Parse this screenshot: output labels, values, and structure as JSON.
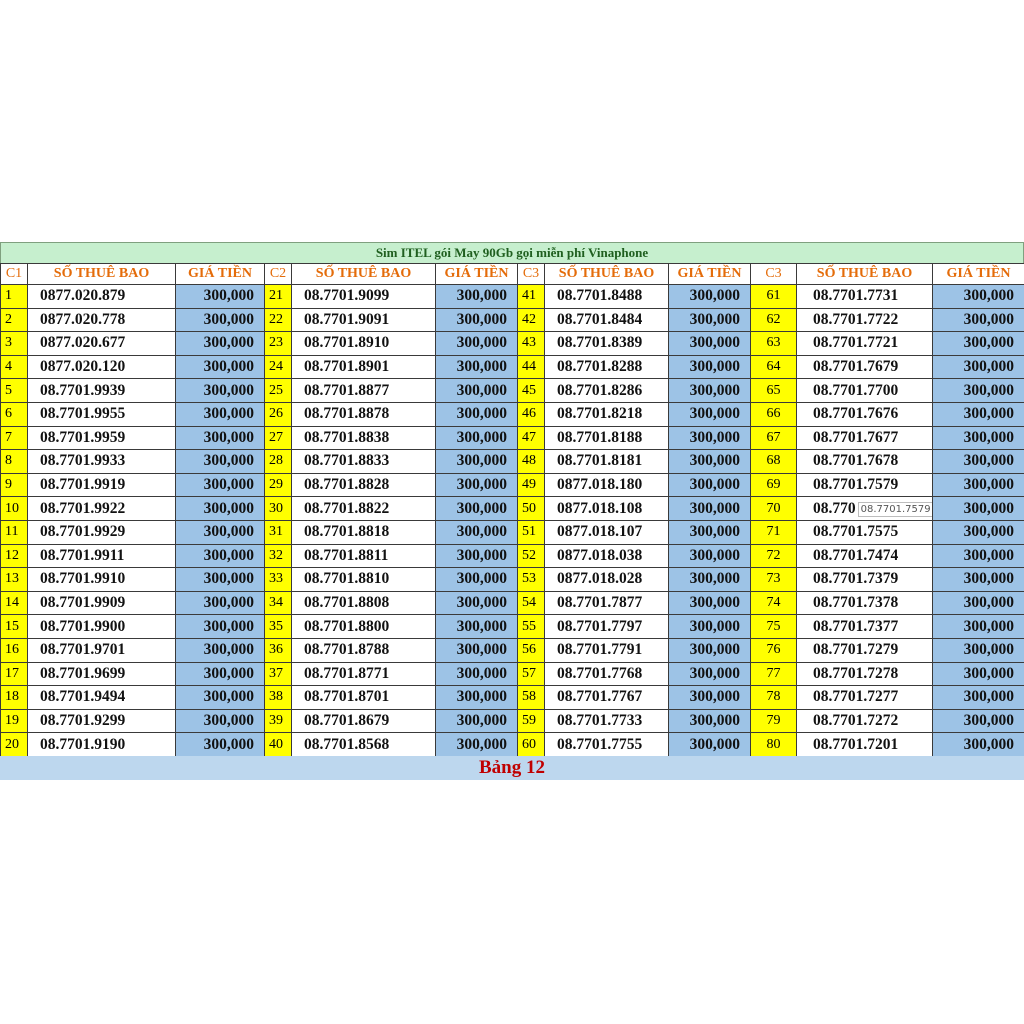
{
  "title": "Sim ITEL gói May 90Gb gọi miễn phí Vinaphone",
  "headers": {
    "groups": [
      "C1",
      "C2",
      "C3",
      "C3"
    ],
    "number_col": "SỐ THUÊ BAO",
    "price_col": "GIÁ TIỀN"
  },
  "tooltip": "08.7701.7579",
  "footer": "Bảng 12",
  "colors": {
    "title_bg": "#c6efce",
    "index_bg": "#ffff00",
    "price_bg": "#9dc3e6",
    "header_text": "#e46c0a",
    "footer_bg": "#bdd7ee",
    "footer_text": "#c00000"
  },
  "rows": [
    [
      {
        "i": "1",
        "n": "0877.020.879",
        "p": "300,000"
      },
      {
        "i": "21",
        "n": "08.7701.9099",
        "p": "300,000"
      },
      {
        "i": "41",
        "n": "08.7701.8488",
        "p": "300,000"
      },
      {
        "i": "61",
        "n": "08.7701.7731",
        "p": "300,000"
      }
    ],
    [
      {
        "i": "2",
        "n": "0877.020.778",
        "p": "300,000"
      },
      {
        "i": "22",
        "n": "08.7701.9091",
        "p": "300,000"
      },
      {
        "i": "42",
        "n": "08.7701.8484",
        "p": "300,000"
      },
      {
        "i": "62",
        "n": "08.7701.7722",
        "p": "300,000"
      }
    ],
    [
      {
        "i": "3",
        "n": "0877.020.677",
        "p": "300,000"
      },
      {
        "i": "23",
        "n": "08.7701.8910",
        "p": "300,000"
      },
      {
        "i": "43",
        "n": "08.7701.8389",
        "p": "300,000"
      },
      {
        "i": "63",
        "n": "08.7701.7721",
        "p": "300,000"
      }
    ],
    [
      {
        "i": "4",
        "n": "0877.020.120",
        "p": "300,000"
      },
      {
        "i": "24",
        "n": "08.7701.8901",
        "p": "300,000"
      },
      {
        "i": "44",
        "n": "08.7701.8288",
        "p": "300,000"
      },
      {
        "i": "64",
        "n": "08.7701.7679",
        "p": "300,000"
      }
    ],
    [
      {
        "i": "5",
        "n": "08.7701.9939",
        "p": "300,000"
      },
      {
        "i": "25",
        "n": "08.7701.8877",
        "p": "300,000"
      },
      {
        "i": "45",
        "n": "08.7701.8286",
        "p": "300,000"
      },
      {
        "i": "65",
        "n": "08.7701.7700",
        "p": "300,000"
      }
    ],
    [
      {
        "i": "6",
        "n": "08.7701.9955",
        "p": "300,000"
      },
      {
        "i": "26",
        "n": "08.7701.8878",
        "p": "300,000"
      },
      {
        "i": "46",
        "n": "08.7701.8218",
        "p": "300,000"
      },
      {
        "i": "66",
        "n": "08.7701.7676",
        "p": "300,000"
      }
    ],
    [
      {
        "i": "7",
        "n": "08.7701.9959",
        "p": "300,000"
      },
      {
        "i": "27",
        "n": "08.7701.8838",
        "p": "300,000"
      },
      {
        "i": "47",
        "n": "08.7701.8188",
        "p": "300,000"
      },
      {
        "i": "67",
        "n": "08.7701.7677",
        "p": "300,000"
      }
    ],
    [
      {
        "i": "8",
        "n": "08.7701.9933",
        "p": "300,000"
      },
      {
        "i": "28",
        "n": "08.7701.8833",
        "p": "300,000"
      },
      {
        "i": "48",
        "n": "08.7701.8181",
        "p": "300,000"
      },
      {
        "i": "68",
        "n": "08.7701.7678",
        "p": "300,000"
      }
    ],
    [
      {
        "i": "9",
        "n": "08.7701.9919",
        "p": "300,000"
      },
      {
        "i": "29",
        "n": "08.7701.8828",
        "p": "300,000"
      },
      {
        "i": "49",
        "n": "0877.018.180",
        "p": "300,000"
      },
      {
        "i": "69",
        "n": "08.7701.7579",
        "p": "300,000"
      }
    ],
    [
      {
        "i": "10",
        "n": "08.7701.9922",
        "p": "300,000"
      },
      {
        "i": "30",
        "n": "08.7701.8822",
        "p": "300,000"
      },
      {
        "i": "50",
        "n": "0877.018.108",
        "p": "300,000"
      },
      {
        "i": "70",
        "n": "08.770",
        "p": "300,000"
      }
    ],
    [
      {
        "i": "11",
        "n": "08.7701.9929",
        "p": "300,000"
      },
      {
        "i": "31",
        "n": "08.7701.8818",
        "p": "300,000"
      },
      {
        "i": "51",
        "n": "0877.018.107",
        "p": "300,000"
      },
      {
        "i": "71",
        "n": "08.7701.7575",
        "p": "300,000"
      }
    ],
    [
      {
        "i": "12",
        "n": "08.7701.9911",
        "p": "300,000"
      },
      {
        "i": "32",
        "n": "08.7701.8811",
        "p": "300,000"
      },
      {
        "i": "52",
        "n": "0877.018.038",
        "p": "300,000"
      },
      {
        "i": "72",
        "n": "08.7701.7474",
        "p": "300,000"
      }
    ],
    [
      {
        "i": "13",
        "n": "08.7701.9910",
        "p": "300,000"
      },
      {
        "i": "33",
        "n": "08.7701.8810",
        "p": "300,000"
      },
      {
        "i": "53",
        "n": "0877.018.028",
        "p": "300,000"
      },
      {
        "i": "73",
        "n": "08.7701.7379",
        "p": "300,000"
      }
    ],
    [
      {
        "i": "14",
        "n": "08.7701.9909",
        "p": "300,000"
      },
      {
        "i": "34",
        "n": "08.7701.8808",
        "p": "300,000"
      },
      {
        "i": "54",
        "n": "08.7701.7877",
        "p": "300,000"
      },
      {
        "i": "74",
        "n": "08.7701.7378",
        "p": "300,000"
      }
    ],
    [
      {
        "i": "15",
        "n": "08.7701.9900",
        "p": "300,000"
      },
      {
        "i": "35",
        "n": "08.7701.8800",
        "p": "300,000"
      },
      {
        "i": "55",
        "n": "08.7701.7797",
        "p": "300,000"
      },
      {
        "i": "75",
        "n": "08.7701.7377",
        "p": "300,000"
      }
    ],
    [
      {
        "i": "16",
        "n": "08.7701.9701",
        "p": "300,000"
      },
      {
        "i": "36",
        "n": "08.7701.8788",
        "p": "300,000"
      },
      {
        "i": "56",
        "n": "08.7701.7791",
        "p": "300,000"
      },
      {
        "i": "76",
        "n": "08.7701.7279",
        "p": "300,000"
      }
    ],
    [
      {
        "i": "17",
        "n": "08.7701.9699",
        "p": "300,000"
      },
      {
        "i": "37",
        "n": "08.7701.8771",
        "p": "300,000"
      },
      {
        "i": "57",
        "n": "08.7701.7768",
        "p": "300,000"
      },
      {
        "i": "77",
        "n": "08.7701.7278",
        "p": "300,000"
      }
    ],
    [
      {
        "i": "18",
        "n": "08.7701.9494",
        "p": "300,000"
      },
      {
        "i": "38",
        "n": "08.7701.8701",
        "p": "300,000"
      },
      {
        "i": "58",
        "n": "08.7701.7767",
        "p": "300,000"
      },
      {
        "i": "78",
        "n": "08.7701.7277",
        "p": "300,000"
      }
    ],
    [
      {
        "i": "19",
        "n": "08.7701.9299",
        "p": "300,000"
      },
      {
        "i": "39",
        "n": "08.7701.8679",
        "p": "300,000"
      },
      {
        "i": "59",
        "n": "08.7701.7733",
        "p": "300,000"
      },
      {
        "i": "79",
        "n": "08.7701.7272",
        "p": "300,000"
      }
    ],
    [
      {
        "i": "20",
        "n": "08.7701.9190",
        "p": "300,000"
      },
      {
        "i": "40",
        "n": "08.7701.8568",
        "p": "300,000"
      },
      {
        "i": "60",
        "n": "08.7701.7755",
        "p": "300,000"
      },
      {
        "i": "80",
        "n": "08.7701.7201",
        "p": "300,000"
      }
    ]
  ]
}
